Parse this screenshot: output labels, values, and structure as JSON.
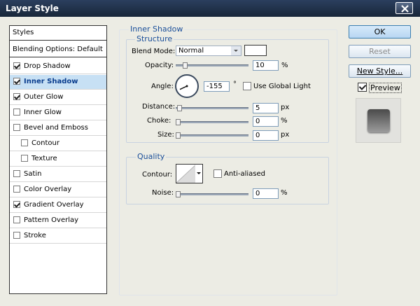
{
  "window": {
    "title": "Layer Style"
  },
  "styles_panel": {
    "header": "Styles",
    "blending": "Blending Options: Default",
    "items": [
      {
        "label": "Drop Shadow",
        "checked": true,
        "selected": false,
        "indent": false
      },
      {
        "label": "Inner Shadow",
        "checked": true,
        "selected": true,
        "indent": false
      },
      {
        "label": "Outer Glow",
        "checked": true,
        "selected": false,
        "indent": false
      },
      {
        "label": "Inner Glow",
        "checked": false,
        "selected": false,
        "indent": false
      },
      {
        "label": "Bevel and Emboss",
        "checked": false,
        "selected": false,
        "indent": false
      },
      {
        "label": "Contour",
        "checked": false,
        "selected": false,
        "indent": true
      },
      {
        "label": "Texture",
        "checked": false,
        "selected": false,
        "indent": true
      },
      {
        "label": "Satin",
        "checked": false,
        "selected": false,
        "indent": false
      },
      {
        "label": "Color Overlay",
        "checked": false,
        "selected": false,
        "indent": false
      },
      {
        "label": "Gradient Overlay",
        "checked": true,
        "selected": false,
        "indent": false
      },
      {
        "label": "Pattern Overlay",
        "checked": false,
        "selected": false,
        "indent": false
      },
      {
        "label": "Stroke",
        "checked": false,
        "selected": false,
        "indent": false
      }
    ]
  },
  "inner_shadow": {
    "title": "Inner Shadow",
    "structure": {
      "title": "Structure",
      "blend_mode": {
        "label": "Blend Mode:",
        "value": "Normal",
        "color": "#ffffff"
      },
      "opacity": {
        "label": "Opacity:",
        "value": "10",
        "unit": "%",
        "level": 0.1
      },
      "angle": {
        "label": "Angle:",
        "value": "-155",
        "unit": "°",
        "degrees": -155
      },
      "use_global_light": {
        "label": "Use Global Light",
        "checked": false
      },
      "distance": {
        "label": "Distance:",
        "value": "5",
        "unit": "px",
        "level": 0.02
      },
      "choke": {
        "label": "Choke:",
        "value": "0",
        "unit": "%",
        "level": 0
      },
      "size": {
        "label": "Size:",
        "value": "0",
        "unit": "px",
        "level": 0
      }
    },
    "quality": {
      "title": "Quality",
      "contour": {
        "label": "Contour:"
      },
      "anti_aliased": {
        "label": "Anti-aliased",
        "checked": false
      },
      "noise": {
        "label": "Noise:",
        "value": "0",
        "unit": "%",
        "level": 0
      }
    }
  },
  "buttons": {
    "ok": "OK",
    "reset": "Reset",
    "new_style": "New Style..."
  },
  "preview": {
    "label": "Preview",
    "checked": true
  },
  "colors": {
    "title_bar": "#1f2f48",
    "selected_item": "#c7e0f4",
    "group_title": "#1b4f9a",
    "background": "#ecece4"
  }
}
